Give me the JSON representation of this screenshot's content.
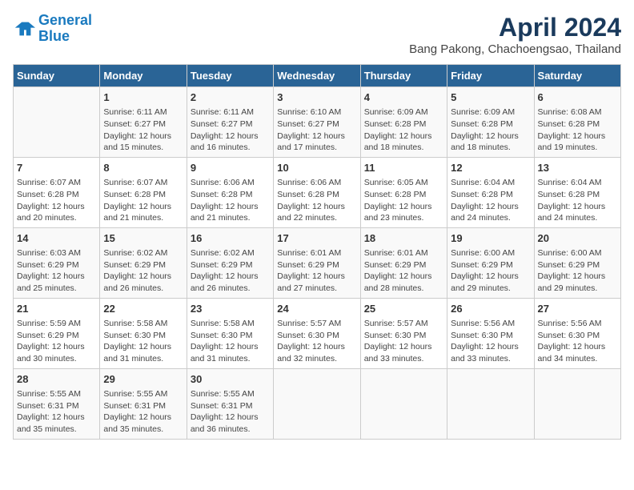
{
  "header": {
    "logo_line1": "General",
    "logo_line2": "Blue",
    "main_title": "April 2024",
    "subtitle": "Bang Pakong, Chachoengsao, Thailand"
  },
  "days_of_week": [
    "Sunday",
    "Monday",
    "Tuesday",
    "Wednesday",
    "Thursday",
    "Friday",
    "Saturday"
  ],
  "weeks": [
    [
      {
        "day": "",
        "info": ""
      },
      {
        "day": "1",
        "info": "Sunrise: 6:11 AM\nSunset: 6:27 PM\nDaylight: 12 hours\nand 15 minutes."
      },
      {
        "day": "2",
        "info": "Sunrise: 6:11 AM\nSunset: 6:27 PM\nDaylight: 12 hours\nand 16 minutes."
      },
      {
        "day": "3",
        "info": "Sunrise: 6:10 AM\nSunset: 6:27 PM\nDaylight: 12 hours\nand 17 minutes."
      },
      {
        "day": "4",
        "info": "Sunrise: 6:09 AM\nSunset: 6:28 PM\nDaylight: 12 hours\nand 18 minutes."
      },
      {
        "day": "5",
        "info": "Sunrise: 6:09 AM\nSunset: 6:28 PM\nDaylight: 12 hours\nand 18 minutes."
      },
      {
        "day": "6",
        "info": "Sunrise: 6:08 AM\nSunset: 6:28 PM\nDaylight: 12 hours\nand 19 minutes."
      }
    ],
    [
      {
        "day": "7",
        "info": "Sunrise: 6:07 AM\nSunset: 6:28 PM\nDaylight: 12 hours\nand 20 minutes."
      },
      {
        "day": "8",
        "info": "Sunrise: 6:07 AM\nSunset: 6:28 PM\nDaylight: 12 hours\nand 21 minutes."
      },
      {
        "day": "9",
        "info": "Sunrise: 6:06 AM\nSunset: 6:28 PM\nDaylight: 12 hours\nand 21 minutes."
      },
      {
        "day": "10",
        "info": "Sunrise: 6:06 AM\nSunset: 6:28 PM\nDaylight: 12 hours\nand 22 minutes."
      },
      {
        "day": "11",
        "info": "Sunrise: 6:05 AM\nSunset: 6:28 PM\nDaylight: 12 hours\nand 23 minutes."
      },
      {
        "day": "12",
        "info": "Sunrise: 6:04 AM\nSunset: 6:28 PM\nDaylight: 12 hours\nand 24 minutes."
      },
      {
        "day": "13",
        "info": "Sunrise: 6:04 AM\nSunset: 6:28 PM\nDaylight: 12 hours\nand 24 minutes."
      }
    ],
    [
      {
        "day": "14",
        "info": "Sunrise: 6:03 AM\nSunset: 6:29 PM\nDaylight: 12 hours\nand 25 minutes."
      },
      {
        "day": "15",
        "info": "Sunrise: 6:02 AM\nSunset: 6:29 PM\nDaylight: 12 hours\nand 26 minutes."
      },
      {
        "day": "16",
        "info": "Sunrise: 6:02 AM\nSunset: 6:29 PM\nDaylight: 12 hours\nand 26 minutes."
      },
      {
        "day": "17",
        "info": "Sunrise: 6:01 AM\nSunset: 6:29 PM\nDaylight: 12 hours\nand 27 minutes."
      },
      {
        "day": "18",
        "info": "Sunrise: 6:01 AM\nSunset: 6:29 PM\nDaylight: 12 hours\nand 28 minutes."
      },
      {
        "day": "19",
        "info": "Sunrise: 6:00 AM\nSunset: 6:29 PM\nDaylight: 12 hours\nand 29 minutes."
      },
      {
        "day": "20",
        "info": "Sunrise: 6:00 AM\nSunset: 6:29 PM\nDaylight: 12 hours\nand 29 minutes."
      }
    ],
    [
      {
        "day": "21",
        "info": "Sunrise: 5:59 AM\nSunset: 6:29 PM\nDaylight: 12 hours\nand 30 minutes."
      },
      {
        "day": "22",
        "info": "Sunrise: 5:58 AM\nSunset: 6:30 PM\nDaylight: 12 hours\nand 31 minutes."
      },
      {
        "day": "23",
        "info": "Sunrise: 5:58 AM\nSunset: 6:30 PM\nDaylight: 12 hours\nand 31 minutes."
      },
      {
        "day": "24",
        "info": "Sunrise: 5:57 AM\nSunset: 6:30 PM\nDaylight: 12 hours\nand 32 minutes."
      },
      {
        "day": "25",
        "info": "Sunrise: 5:57 AM\nSunset: 6:30 PM\nDaylight: 12 hours\nand 33 minutes."
      },
      {
        "day": "26",
        "info": "Sunrise: 5:56 AM\nSunset: 6:30 PM\nDaylight: 12 hours\nand 33 minutes."
      },
      {
        "day": "27",
        "info": "Sunrise: 5:56 AM\nSunset: 6:30 PM\nDaylight: 12 hours\nand 34 minutes."
      }
    ],
    [
      {
        "day": "28",
        "info": "Sunrise: 5:55 AM\nSunset: 6:31 PM\nDaylight: 12 hours\nand 35 minutes."
      },
      {
        "day": "29",
        "info": "Sunrise: 5:55 AM\nSunset: 6:31 PM\nDaylight: 12 hours\nand 35 minutes."
      },
      {
        "day": "30",
        "info": "Sunrise: 5:55 AM\nSunset: 6:31 PM\nDaylight: 12 hours\nand 36 minutes."
      },
      {
        "day": "",
        "info": ""
      },
      {
        "day": "",
        "info": ""
      },
      {
        "day": "",
        "info": ""
      },
      {
        "day": "",
        "info": ""
      }
    ]
  ]
}
